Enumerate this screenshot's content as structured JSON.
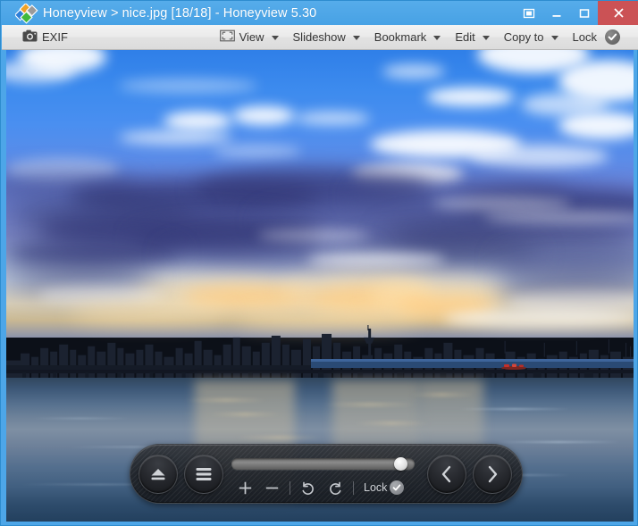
{
  "window": {
    "title": "Honeyview > nice.jpg [18/18] - Honeyview 5.30",
    "app_name": "Honeyview",
    "file_name": "nice.jpg",
    "page_indicator": "[18/18]",
    "version": "Honeyview 5.30",
    "frame_color": "#4da6e8",
    "titlebar_color": "#4ea6e7",
    "close_button_color": "#cb5255",
    "controls": [
      {
        "name": "fullscreen-toggle",
        "icon": "fullscreen-icon",
        "label": ""
      },
      {
        "name": "minimize",
        "icon": "minimize-icon",
        "label": ""
      },
      {
        "name": "maximize",
        "icon": "maximize-icon",
        "label": ""
      },
      {
        "name": "close",
        "icon": "close-icon",
        "label": ""
      }
    ]
  },
  "toolbar": {
    "exif_label": "EXIF",
    "exif_icon": "camera-icon",
    "view_label": "View",
    "view_icon": "fit-to-window-icon",
    "slideshow_label": "Slideshow",
    "bookmark_label": "Bookmark",
    "edit_label": "Edit",
    "copy_to_label": "Copy to",
    "lock_label": "Lock",
    "lock_icon": "check-circle-icon"
  },
  "control_bar": {
    "eject_icon": "eject-icon",
    "menu_icon": "hamburger-menu-icon",
    "zoom_in_icon": "plus-icon",
    "zoom_out_icon": "minus-icon",
    "rotate_left_icon": "rotate-counterclockwise-icon",
    "rotate_right_icon": "rotate-clockwise-icon",
    "lock_label": "Lock",
    "lock_icon": "check-circle-icon",
    "prev_icon": "chevron-left-icon",
    "next_icon": "chevron-right-icon",
    "slider_value_percent": 89
  },
  "image": {
    "description": "Sunset cityscape over a river with dramatic blue and violet clouds, a bridge, distant skyline with tower, and a small red boat on the water",
    "sky_top_color": "#2f7fe8",
    "cloud_dark_color": "#343a78",
    "sunset_glow_color": "#ffce84",
    "water_color": "#56708e",
    "boat_color": "#c4302b"
  }
}
